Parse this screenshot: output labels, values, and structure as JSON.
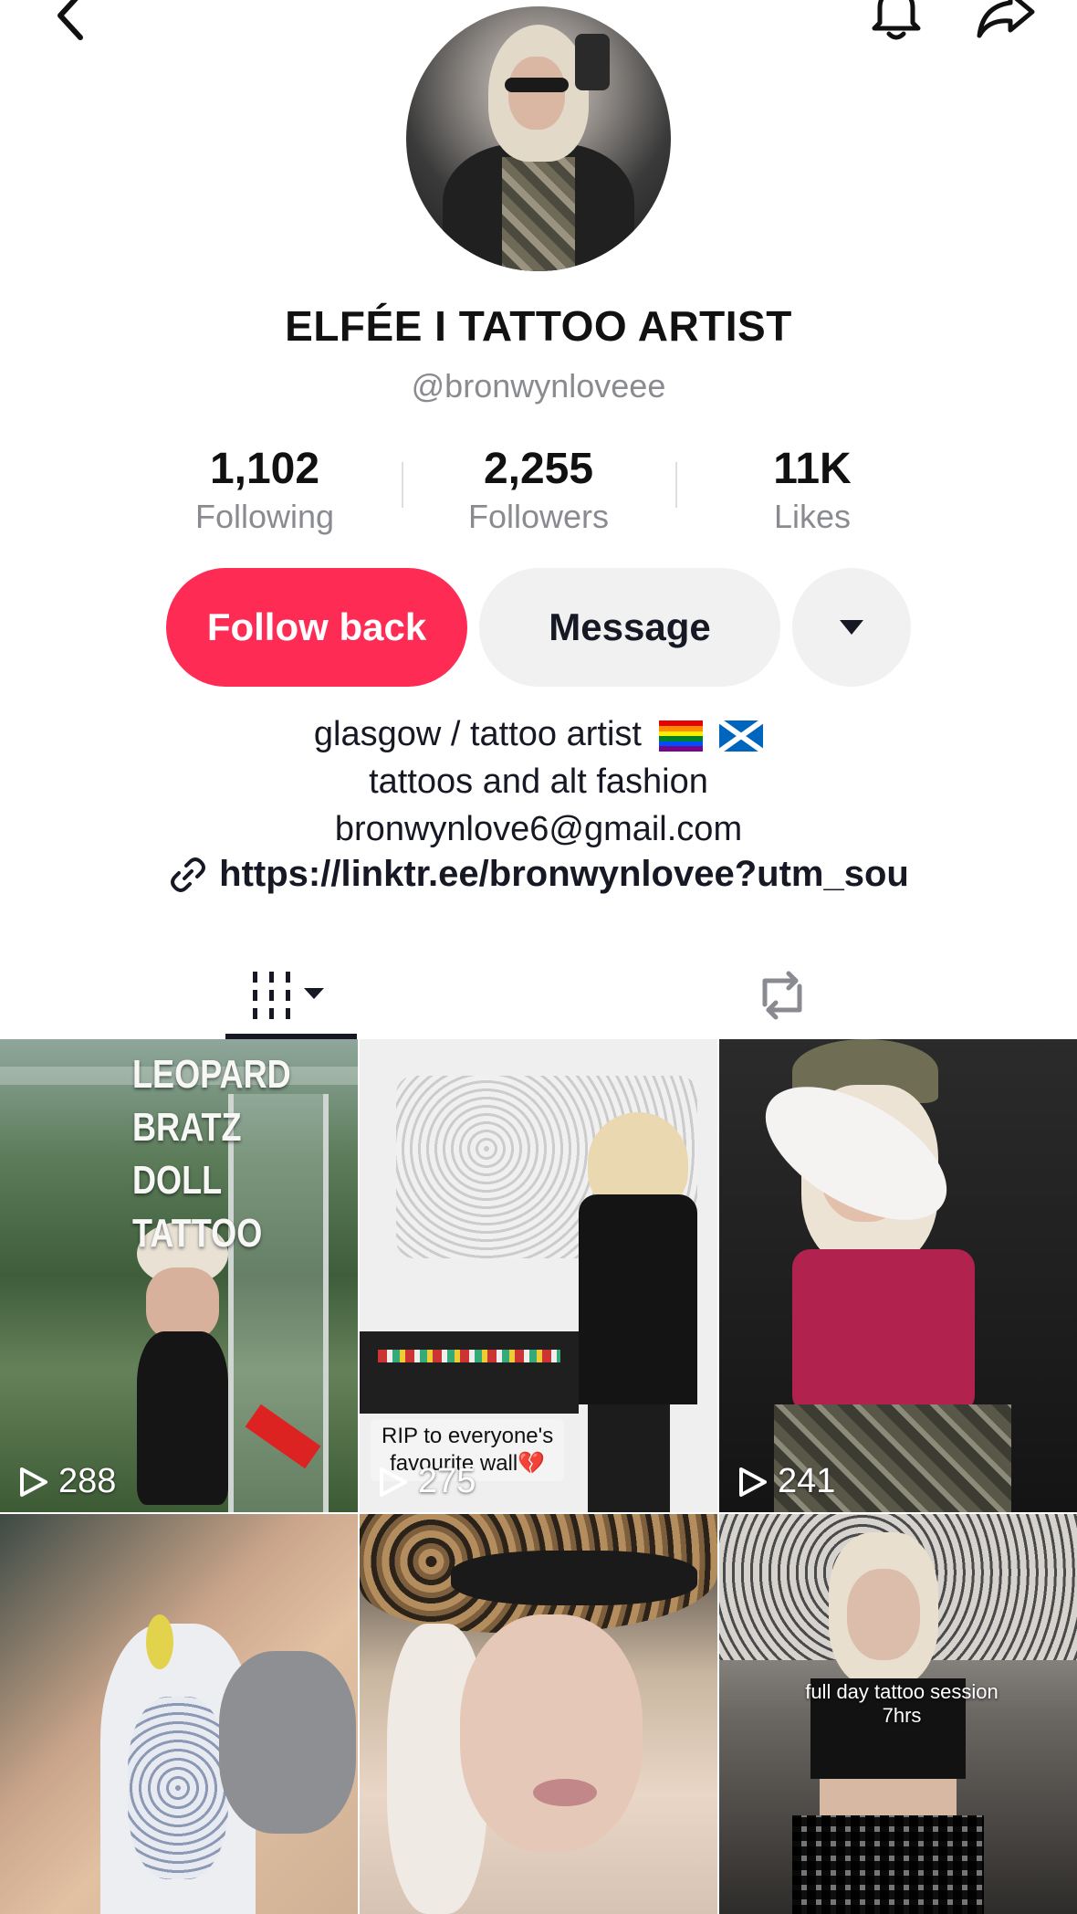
{
  "profile": {
    "display_name": "ELFÉE I TATTOO ARTIST",
    "username": "@bronwynloveee"
  },
  "stats": [
    {
      "value": "1,102",
      "label": "Following"
    },
    {
      "value": "2,255",
      "label": "Followers"
    },
    {
      "value": "11K",
      "label": "Likes"
    }
  ],
  "actions": {
    "follow_back": "Follow back",
    "message": "Message"
  },
  "bio": {
    "line1": "glasgow / tattoo artist",
    "line2": "tattoos and alt fashion",
    "line3": "bronwynlove6@gmail.com",
    "link": "https://linktr.ee/bronwynlovee?utm_sou"
  },
  "videos": [
    {
      "views": "288",
      "overlay": [
        "LEOPARD",
        "BRATZ DOLL",
        "TATTOO"
      ]
    },
    {
      "views": "275",
      "caption": [
        "RIP to everyone's",
        "favourite wall💔"
      ]
    },
    {
      "views": "241"
    },
    {
      "views": ""
    },
    {
      "views": ""
    },
    {
      "views": "",
      "caption": [
        "full day tattoo session",
        "7hrs"
      ]
    }
  ],
  "colors": {
    "accent": "#fe2c55",
    "muted_text": "#8a8b91",
    "button_bg": "#f1f1f2"
  },
  "icons": [
    "back-arrow-icon",
    "bell-icon",
    "share-icon",
    "dropdown-caret-icon",
    "link-icon",
    "videos-grid-icon",
    "repost-icon",
    "play-icon"
  ]
}
